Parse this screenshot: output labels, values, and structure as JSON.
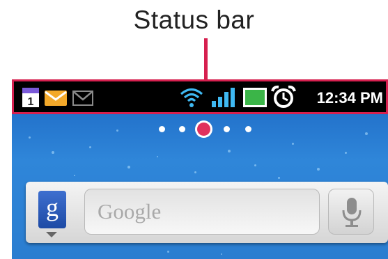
{
  "callout": {
    "label": "Status bar",
    "accent": "#d6204f"
  },
  "status_bar": {
    "left_icons": [
      "calendar-icon",
      "email-icon",
      "gmail-icon"
    ],
    "calendar_day": "1",
    "right_icons": [
      "wifi-icon",
      "signal-icon",
      "battery-icon",
      "alarm-icon"
    ],
    "time": "12:34 PM"
  },
  "home": {
    "page_count": 5,
    "current_page": 3
  },
  "search_widget": {
    "g_label": "g",
    "placeholder": "Google",
    "mic_icon": "mic-icon"
  }
}
